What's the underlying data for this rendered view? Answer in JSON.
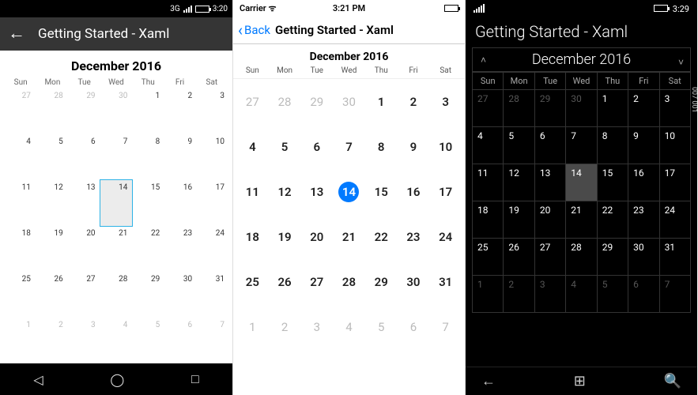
{
  "common": {
    "app_title": "Getting Started - Xaml",
    "month_title": "December 2016",
    "day_names": [
      "Sun",
      "Mon",
      "Tue",
      "Wed",
      "Thu",
      "Fri",
      "Sat"
    ],
    "days": [
      {
        "d": "27",
        "o": true
      },
      {
        "d": "28",
        "o": true
      },
      {
        "d": "29",
        "o": true
      },
      {
        "d": "30",
        "o": true
      },
      {
        "d": "1"
      },
      {
        "d": "2"
      },
      {
        "d": "3"
      },
      {
        "d": "4"
      },
      {
        "d": "5"
      },
      {
        "d": "6"
      },
      {
        "d": "7"
      },
      {
        "d": "8"
      },
      {
        "d": "9"
      },
      {
        "d": "10"
      },
      {
        "d": "11"
      },
      {
        "d": "12"
      },
      {
        "d": "13"
      },
      {
        "d": "14",
        "today": true
      },
      {
        "d": "15"
      },
      {
        "d": "16"
      },
      {
        "d": "17"
      },
      {
        "d": "18"
      },
      {
        "d": "19"
      },
      {
        "d": "20"
      },
      {
        "d": "21"
      },
      {
        "d": "22"
      },
      {
        "d": "23"
      },
      {
        "d": "24"
      },
      {
        "d": "25"
      },
      {
        "d": "26"
      },
      {
        "d": "27"
      },
      {
        "d": "28"
      },
      {
        "d": "29"
      },
      {
        "d": "30"
      },
      {
        "d": "31"
      },
      {
        "d": "1",
        "o": true
      },
      {
        "d": "2",
        "o": true
      },
      {
        "d": "3",
        "o": true
      },
      {
        "d": "4",
        "o": true
      },
      {
        "d": "5",
        "o": true
      },
      {
        "d": "6",
        "o": true
      },
      {
        "d": "7",
        "o": true
      }
    ]
  },
  "android": {
    "net_badge": "3G",
    "time": "3:20"
  },
  "ios": {
    "carrier": "Carrier",
    "time": "3:21 PM",
    "back_label": "Back"
  },
  "uwp": {
    "time": "3:29",
    "watermark": "007 001"
  }
}
